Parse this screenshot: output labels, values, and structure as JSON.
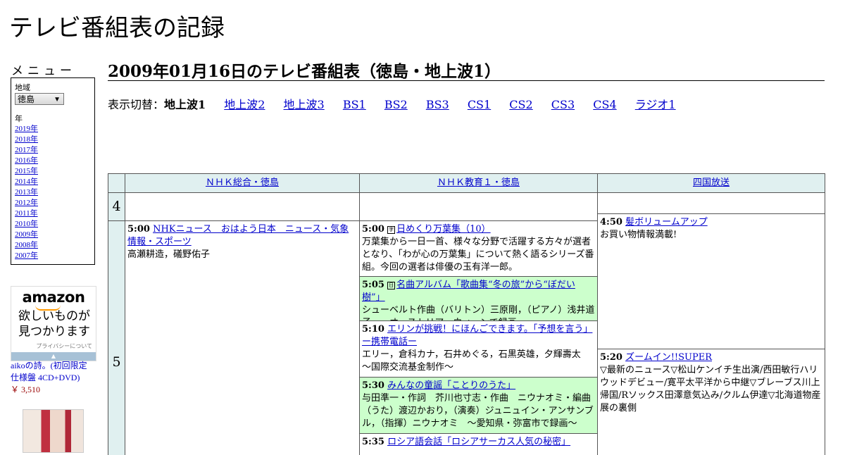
{
  "site_title": "テレビ番組表の記録",
  "menu": {
    "title": "メニュー",
    "region_label": "地域",
    "region_value": "徳島",
    "year_label": "年",
    "years": [
      "2019年",
      "2018年",
      "2017年",
      "2016年",
      "2015年",
      "2014年",
      "2013年",
      "2012年",
      "2011年",
      "2010年",
      "2009年",
      "2008年",
      "2007年"
    ]
  },
  "ad": {
    "logo": "amazon",
    "line1": "欲しいものが",
    "line2": "見つかります",
    "privacy": "プライバシーについて",
    "bar": "▲"
  },
  "product": {
    "title": "aikoの詩。(初回限定仕様盤 4CD+DVD)",
    "price": "￥ 3,510"
  },
  "page_title": "2009年01月16日のテレビ番組表（徳島・地上波1）",
  "switcher": {
    "label": "表示切替：",
    "current": "地上波1",
    "links": [
      "地上波2",
      "地上波3",
      "BS1",
      "BS2",
      "BS3",
      "CS1",
      "CS2",
      "CS3",
      "CS4",
      "ラジオ1"
    ]
  },
  "channels": [
    "ＮＨＫ総合・徳島",
    "ＮＨＫ教育１・徳島",
    "四国放送"
  ],
  "hours": [
    "4",
    "5"
  ],
  "programs": {
    "nhk1": [
      {
        "time": "5:00",
        "title": "NHKニュース　おはよう日本　ニュース・気象情報・スポーツ",
        "desc": "高瀬耕造，礒野佑子"
      }
    ],
    "etv": [
      {
        "time": "5:00",
        "icon": "字",
        "title": "日めくり万葉集（10）",
        "desc": "万葉集から一日一首、様々な分野で活躍する方々が選者となり、「わが心の万葉集」について熱く語るシリーズ番組。今回の選者は俳優の玉有洋一郎。"
      },
      {
        "time": "5:05",
        "icon": "日",
        "title": "名曲アルバム「歌曲集“冬の旅”から“ぼだい樹”」",
        "desc": "シューベルト作曲（バリトン）三原剛，（ピアノ）浅井道子　～オーストリア・ウィーンで録画～"
      },
      {
        "time": "5:10",
        "title": "エリンが挑戦！にほんごできます。「予想を言う」ー携帯電話ー",
        "desc": "エリー，倉科カナ，石井めぐる，石黒英雄，夕輝壽太　～国際交流基金制作～"
      },
      {
        "time": "5:30",
        "title": "みんなの童謡「ことりのうた」",
        "desc": "与田準一・作詞　芥川也寸志・作曲　ニウナオミ・編曲（うた）渡辺かおり，（演奏）ジュニュイン・アンサンブル，（指揮）ニウナオミ　～愛知県・弥富市で録画～"
      },
      {
        "time": "5:35",
        "title": "ロシア語会話「ロシアサーカス人気の秘密」",
        "desc": ""
      }
    ],
    "jrt": [
      {
        "time": "4:50",
        "title": "髪ボリュームアップ",
        "desc": "お買い物情報満載!"
      },
      {
        "time": "5:20",
        "title": "ズームイン!!SUPER",
        "desc": "▽最新のニュース▽松山ケンイチ生出演/西田敏行ハリウッドデビュー/寛平太平洋から中継▽ブレーブス川上帰国/Rソックス田澤意気込み/クルム伊達▽北海道物産展の裏側"
      }
    ]
  }
}
